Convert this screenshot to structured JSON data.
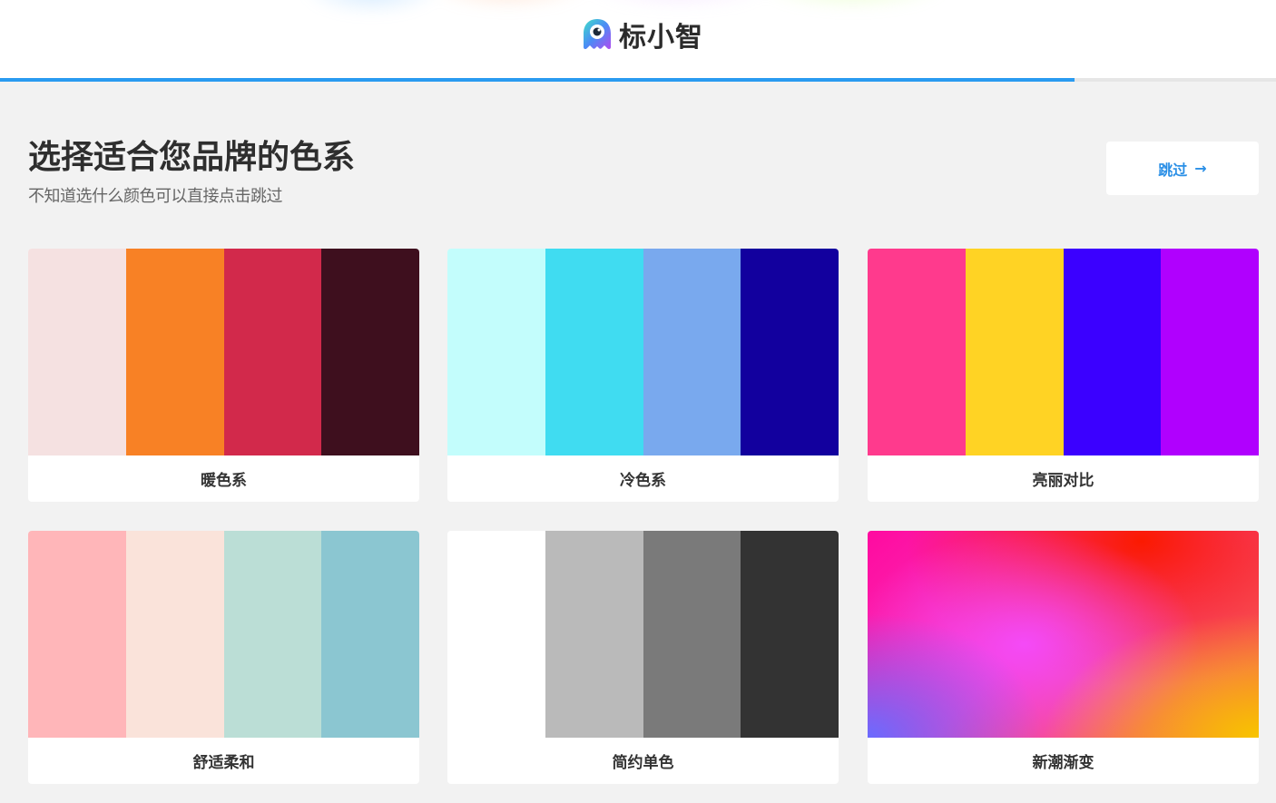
{
  "header": {
    "logo_text": "标小智",
    "progress_percent": 84.2,
    "progress_color": "#2a9bf0"
  },
  "main": {
    "title": "选择适合您品牌的色系",
    "subtitle": "不知道选什么颜色可以直接点击跳过",
    "skip_label": "跳过",
    "skip_icon": "arrow-right-icon"
  },
  "palettes": [
    {
      "label": "暖色系",
      "colors": [
        "#f5e1e1",
        "#f88125",
        "#d2294b",
        "#3e0f1e"
      ]
    },
    {
      "label": "冷色系",
      "colors": [
        "#c3fdfc",
        "#40dcf1",
        "#79a9ee",
        "#12009e"
      ]
    },
    {
      "label": "亮丽对比",
      "colors": [
        "#ff3a8d",
        "#ffd324",
        "#3b00ff",
        "#b000fe"
      ]
    },
    {
      "label": "舒适柔和",
      "colors": [
        "#ffb6b9",
        "#fae3da",
        "#bbded6",
        "#8bc6d1"
      ]
    },
    {
      "label": "简约单色",
      "colors": [
        "#ffffff",
        "#bababa",
        "#7a7a7a",
        "#333333"
      ]
    },
    {
      "label": "新潮渐变",
      "colors": [
        "#ff0aa0",
        "#fb1a00",
        "#f44af7",
        "#6a6bff",
        "#f8c400"
      ]
    }
  ]
}
